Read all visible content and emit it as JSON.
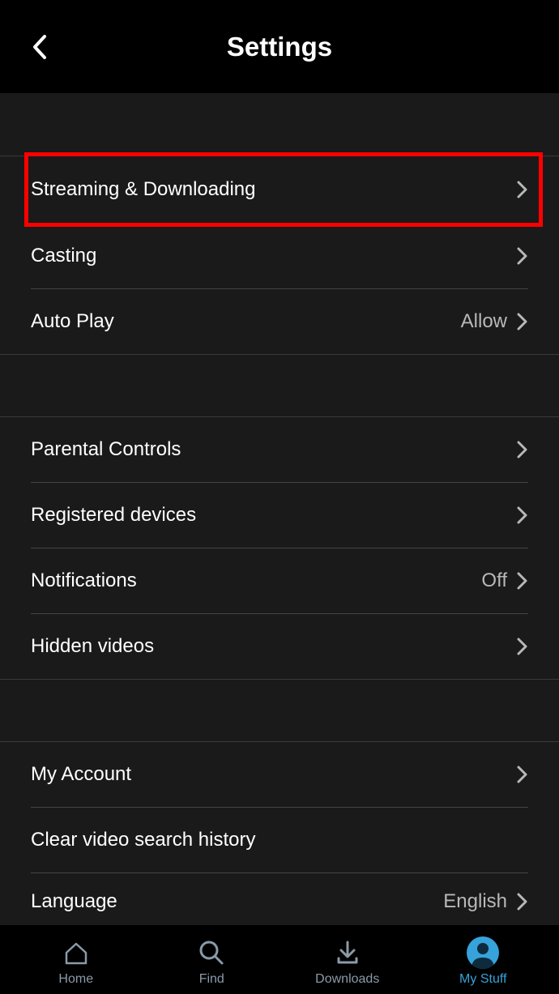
{
  "header": {
    "title": "Settings"
  },
  "sections": {
    "group1": {
      "streaming": {
        "label": "Streaming & Downloading"
      },
      "casting": {
        "label": "Casting"
      },
      "autoplay": {
        "label": "Auto Play",
        "value": "Allow"
      }
    },
    "group2": {
      "parental": {
        "label": "Parental Controls"
      },
      "devices": {
        "label": "Registered devices"
      },
      "notifications": {
        "label": "Notifications",
        "value": "Off"
      },
      "hidden": {
        "label": "Hidden videos"
      }
    },
    "group3": {
      "account": {
        "label": "My Account"
      },
      "clear": {
        "label": "Clear video search history"
      },
      "language": {
        "label": "Language",
        "value": "English"
      }
    }
  },
  "nav": {
    "home": "Home",
    "find": "Find",
    "downloads": "Downloads",
    "mystuff": "My Stuff"
  }
}
